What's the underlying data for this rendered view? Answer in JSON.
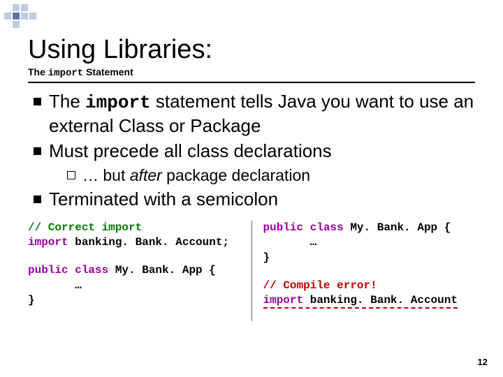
{
  "title": "Using Libraries:",
  "subtitle_prefix": "The ",
  "subtitle_kw": "import",
  "subtitle_suffix": " Statement",
  "bullets": {
    "b1_pre": "The ",
    "b1_kw": "import",
    "b1_post": " statement tells Java you want to use an external Class or Package",
    "b2": "Must precede all class declarations",
    "b2_sub_pre": "… but ",
    "b2_sub_ital": "after",
    "b2_sub_post": " package declaration",
    "b3": "Terminated with a semicolon"
  },
  "code": {
    "left": {
      "l1": "// Correct import",
      "l2a": "import",
      "l2b": " banking. Bank. Account;",
      "l3a": "public class",
      "l3b": " My. Bank. App {",
      "l4": "       …",
      "l5": "}"
    },
    "right": {
      "r1a": "public class",
      "r1b": " My. Bank. App {",
      "r2": "       …",
      "r3": "}",
      "r4": "// Compile error!",
      "r5a": "import",
      "r5b": " banking. Bank. Account"
    }
  },
  "pagenum": "12"
}
